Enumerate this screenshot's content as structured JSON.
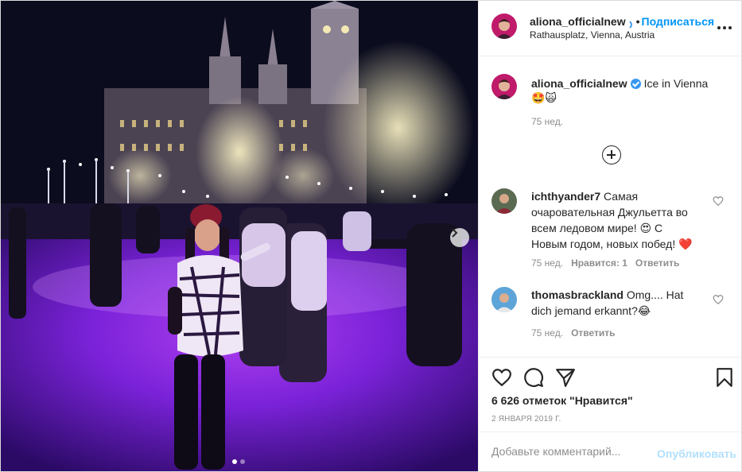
{
  "post": {
    "username": "aliona_officialnew",
    "follow_label": "Подписаться",
    "location": "Rathausplatz, Vienna, Austria",
    "photo_alt": "Ice skating rink in front of Vienna City Hall at night",
    "carousel_count": 2,
    "carousel_active": 1
  },
  "caption": {
    "username": "aliona_officialnew",
    "text": "Ice in Vienna 🤩🙀",
    "time": "75 нед."
  },
  "comments": [
    {
      "username": "ichthyander7",
      "text": "Самая очаровательная Джульетта во всем ледовом мире! 😍 С Новым годом, новых побед! ❤️",
      "time": "75 нед.",
      "likes": "Нравится: 1",
      "reply": "Ответить"
    },
    {
      "username": "thomasbrackland",
      "text": "Omg.... Hat dich jemand erkannt?😂",
      "time": "75 нед.",
      "reply": "Ответить"
    }
  ],
  "actions": {
    "likes_text": "6 626 отметок \"Нравится\"",
    "date": "2 января 2019 г."
  },
  "add_comment": {
    "placeholder": "Добавьте комментарий...",
    "publish_label": "Опубликовать"
  },
  "colors": {
    "link_blue": "#0095f6",
    "publish_disabled": "#b2dffc",
    "heart_red": "#ed4956",
    "muted": "#8e8e8e"
  },
  "icons": {
    "like": "heart-outline-icon",
    "comment": "comment-bubble-icon",
    "share": "paper-plane-icon",
    "save": "bookmark-icon",
    "more": "more-options-icon",
    "load_more": "plus-circle-icon",
    "next": "chevron-right-icon"
  }
}
